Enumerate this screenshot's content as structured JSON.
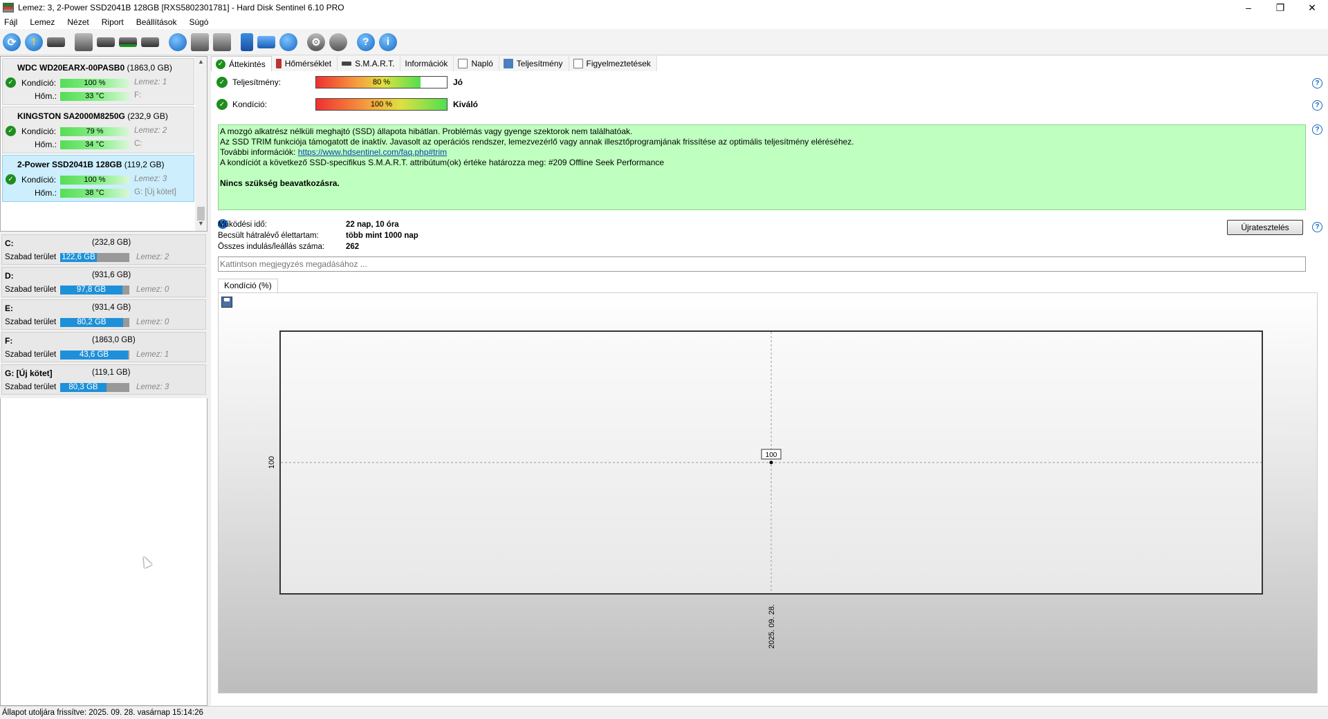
{
  "window": {
    "title": "Lemez: 3, 2-Power SSD2041B 128GB [RXS5802301781]  - Hard Disk Sentinel 6.10 PRO",
    "controls": [
      "–",
      "❐",
      "✕"
    ]
  },
  "menu": [
    "Fájl",
    "Lemez",
    "Nézet",
    "Riport",
    "Beállítások",
    "Súgó"
  ],
  "toolbar_icons": [
    "refresh-icon",
    "refresh-warning-icon",
    "disk-list-icon",
    "disk-gray-icon",
    "disk-clock-icon",
    "disk-check-icon",
    "disk-search-icon",
    "disk-globe-icon",
    "tools-icon",
    "transfer-icon",
    "notes-icon",
    "mail-icon",
    "network-icon",
    "settings-gear-icon",
    "speaker-icon",
    "help-icon",
    "info-icon"
  ],
  "disks": [
    {
      "name": "WDC WD20EARX-00PASB0",
      "size": "(1863,0 GB)",
      "health_label": "Kondíció:",
      "health": "100 %",
      "health_pct": 100,
      "temp_label": "Hőm.:",
      "temp": "33 °C",
      "disk_ref": "Lemez: 1",
      "drive": "F:"
    },
    {
      "name": "KINGSTON SA2000M8250G",
      "size": "(232,9 GB)",
      "health_label": "Kondíció:",
      "health": "79 %",
      "health_pct": 79,
      "temp_label": "Hőm.:",
      "temp": "34 °C",
      "disk_ref": "Lemez: 2",
      "drive": "C:"
    },
    {
      "name": "2-Power SSD2041B 128GB",
      "size": "(119,2 GB)",
      "health_label": "Kondíció:",
      "health": "100 %",
      "health_pct": 100,
      "temp_label": "Hőm.:",
      "temp": "38 °C",
      "disk_ref": "Lemez: 3",
      "drive": "G: [Új kötet]"
    }
  ],
  "volumes": [
    {
      "name": "C:",
      "size": "(232,8 GB)",
      "free_label": "Szabad terület",
      "free": "122,6 GB",
      "free_fraction": 0.53,
      "disk_ref": "Lemez: 2"
    },
    {
      "name": "D:",
      "size": "(931,6 GB)",
      "free_label": "Szabad terület",
      "free": "97,8 GB",
      "free_fraction": 0.9,
      "disk_ref": "Lemez: 0"
    },
    {
      "name": "E:",
      "size": "(931,4 GB)",
      "free_label": "Szabad terület",
      "free": "80,2 GB",
      "free_fraction": 0.91,
      "disk_ref": "Lemez: 0"
    },
    {
      "name": "F:",
      "size": "(1863,0 GB)",
      "free_label": "Szabad terület",
      "free": "43,6 GB",
      "free_fraction": 0.98,
      "disk_ref": "Lemez: 1"
    },
    {
      "name": "G: [Új kötet]",
      "size": "(119,1 GB)",
      "free_label": "Szabad terület",
      "free": "80,3 GB",
      "free_fraction": 0.67,
      "disk_ref": "Lemez: 3"
    }
  ],
  "tabs": [
    "Áttekintés",
    "Hőmérséklet",
    "S.M.A.R.T.",
    "Információk",
    "Napló",
    "Teljesítmény",
    "Figyelmeztetések"
  ],
  "performance": {
    "label": "Teljesítmény:",
    "value": "80 %",
    "pct": 80,
    "rating": "Jó"
  },
  "health": {
    "label": "Kondíció:",
    "value": "100 %",
    "pct": 100,
    "rating": "Kiváló"
  },
  "status_text": {
    "line1": "A mozgó alkatrész nélküli meghajtó (SSD) állapota hibátlan. Problémás vagy gyenge szektorok nem találhatóak.",
    "line2": "Az SSD TRIM funkciója támogatott de inaktív. Javasolt az operációs rendszer, lemezvezérlő vagy annak illesztőprogramjának frissítése az optimális teljesítmény eléréséhez.",
    "line3_prefix": "További információk: ",
    "line3_link": "https://www.hdsentinel.com/faq.php#trim",
    "line4": "A kondíciót a következő SSD-specifikus S.M.A.R.T. attribútum(ok) értéke határozza meg:  #209 Offline Seek Performance",
    "action": "Nincs szükség beavatkozásra."
  },
  "stats": [
    {
      "key": "Működési idő:",
      "value": "22 nap, 10 óra"
    },
    {
      "key": "Becsült hátralévő élettartam:",
      "value": "több mint 1000 nap"
    },
    {
      "key": "Összes indulás/leállás száma:",
      "value": "262"
    }
  ],
  "retest_label": "Újratesztelés",
  "note_placeholder": "Kattintson megjegyzés megadásához ...",
  "chart_tab": "Kondíció  (%)",
  "chart_data": {
    "type": "line",
    "x": [
      "2025. 09. 28."
    ],
    "values": [
      100
    ],
    "data_labels": [
      "100"
    ],
    "y_tick_labels": [
      "100"
    ],
    "x_tick_labels": [
      "2025. 09. 28."
    ],
    "title": "",
    "xlabel": "",
    "ylabel": "",
    "ylim": [
      99,
      101
    ],
    "grid": true
  },
  "statusbar": "Állapot utoljára frissítve: 2025. 09. 28. vasárnap 15:14:26"
}
